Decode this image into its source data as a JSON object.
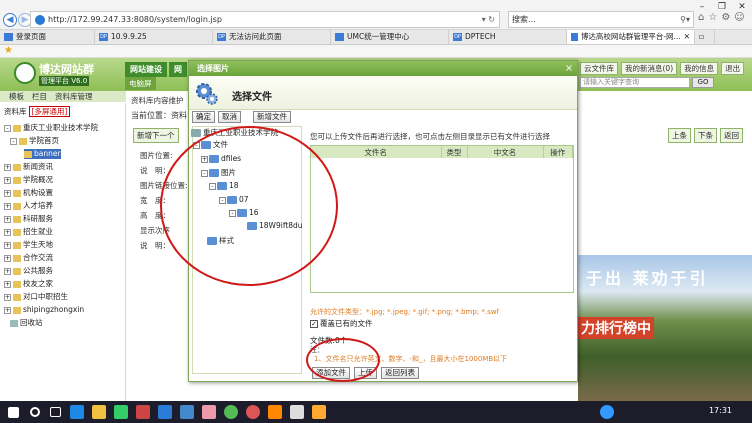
{
  "browser": {
    "url": "http://172.99.247.33:8080/system/login.jsp",
    "search_placeholder": "搜索...",
    "tabs": [
      "登录页面",
      "10.9.9.25",
      "无法访问此页面",
      "UMC统一管理中心",
      "DPTECH",
      "博达高校网站群管理平台-网..."
    ],
    "tab_icons": [
      "",
      "DP",
      "DP",
      "",
      "DP",
      ""
    ]
  },
  "app": {
    "logo_name": "博达网站群",
    "logo_sub": "管理平台  V6.0",
    "top_nav": [
      "网站建设",
      "网"
    ],
    "sub_nav": "电脑屏",
    "header_right": [
      "云文件库",
      "我的新消息(0)",
      "我的信息",
      "退出"
    ],
    "site_input_placeholder": "请输入关键字查询",
    "go_label": "GO"
  },
  "left": {
    "tabs": [
      "模板",
      "栏目",
      "资料库管理"
    ],
    "tree_header": "资料库",
    "tree_header_badge": "[多屏通用]",
    "items": [
      "重庆工业职业技术学院",
      "学院首页",
      "banner",
      "新闻资讯",
      "学院概况",
      "机构设置",
      "人才培养",
      "科研服务",
      "招生就业",
      "学生天地",
      "合作交流",
      "公共服务",
      "校友之家",
      "对口中职招生",
      "shipingzhongxin",
      "回收站"
    ]
  },
  "main": {
    "header": "资料库内容维护",
    "location": "当前位置：资料",
    "new_btn": "新增下一个",
    "right_btns": [
      "上条",
      "下条",
      "返回"
    ],
    "form_labels": [
      "图片位置:",
      "说　明：",
      "图片链接位置:",
      "宽　度：",
      "高　度：",
      "显示次序",
      "说　明："
    ],
    "banner_text": "于出  莱劝于引",
    "banner_badge": "力排行榜中"
  },
  "dialog": {
    "title": "选择图片",
    "close": "×",
    "head_title": "选择文件",
    "toolbar": [
      "确定",
      "取消",
      "新增文件"
    ],
    "tree": {
      "root": "重庆工业职业技术学院",
      "n1": "文件",
      "n2": "dfiles",
      "n3": "图片",
      "n4": "18",
      "n5": "07",
      "n6": "16",
      "n7": "18W9ift8du",
      "n8": "样式"
    },
    "hint": "您可以上传文件后再进行选择，也可点击左侧目录显示已有文件进行选择",
    "columns": [
      "文件名",
      "类型",
      "中文名",
      "操作"
    ],
    "allowed_types": "允许的文件类型：*.jpg; *.jpeg; *.gif; *.png; *.bmp; *.swf",
    "overwrite_label": "覆盖已有的文件",
    "file_count": "文件数:0个",
    "ok_label": "注：",
    "rule": "1、文件名只允许英文、数字、-和_，且最大小在1000MB以下",
    "bottom_buttons": [
      "添加文件",
      "上传",
      "返回列表"
    ]
  },
  "taskbar": {
    "clock": "17:31"
  }
}
